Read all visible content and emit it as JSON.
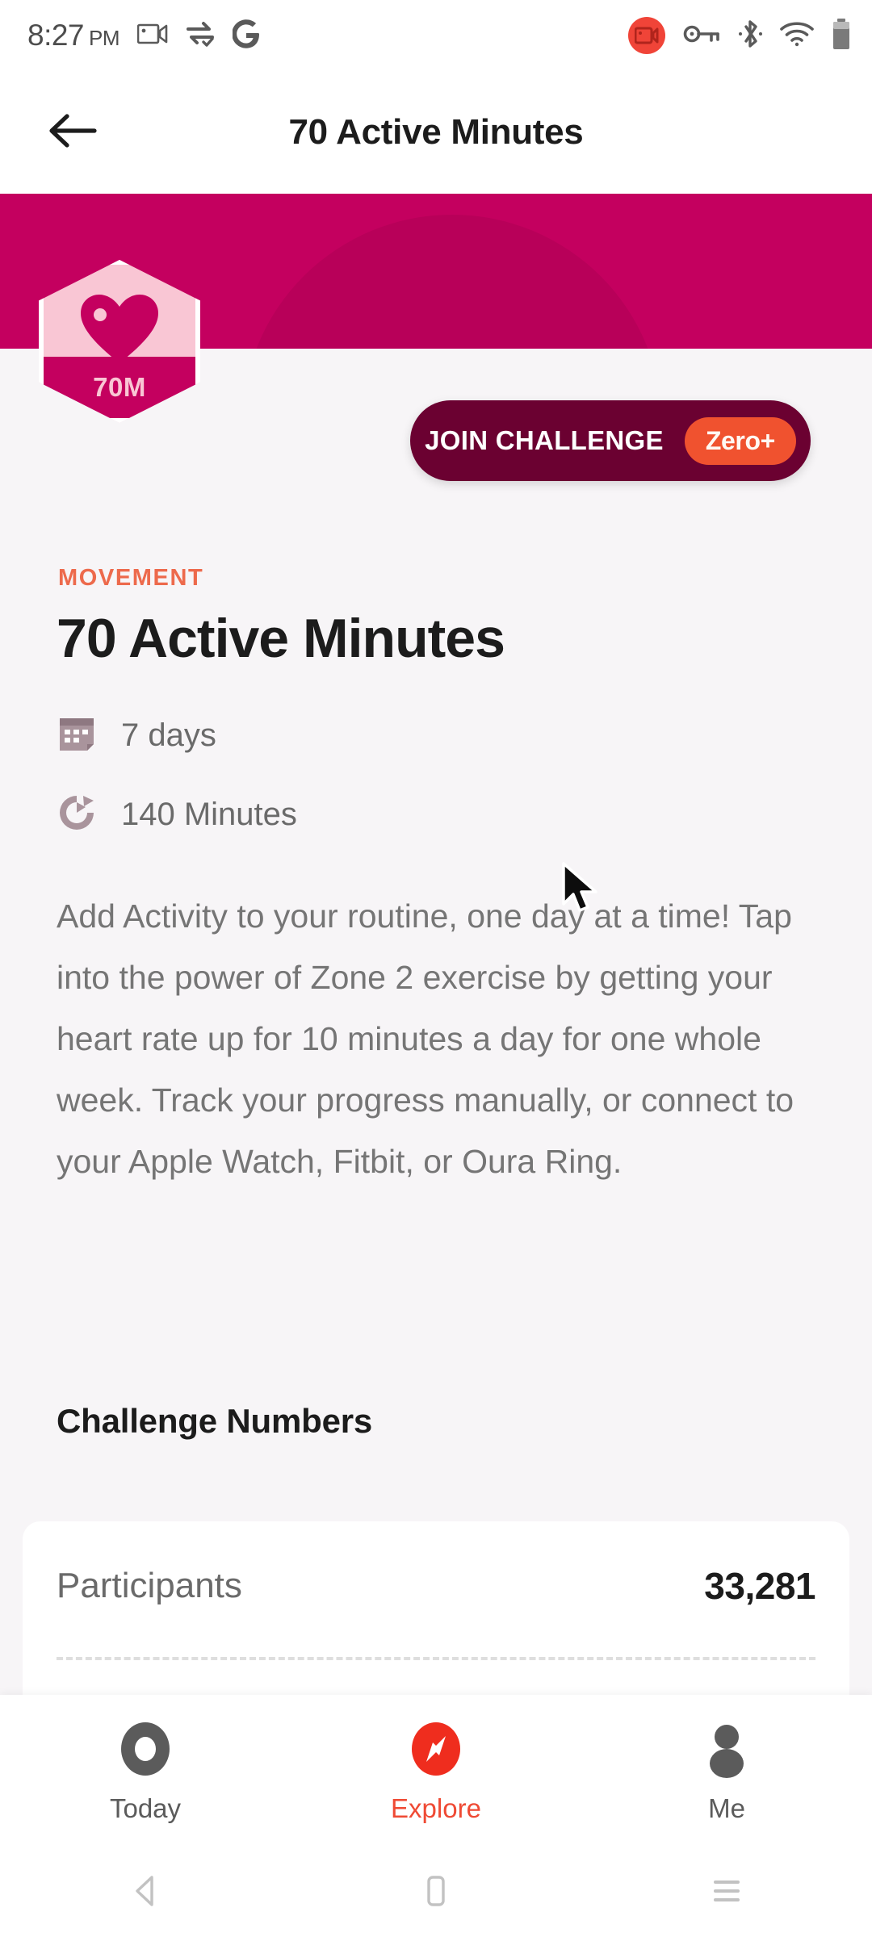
{
  "status_bar": {
    "time": "8:27",
    "ampm": "PM",
    "icons": [
      "screen-record-icon",
      "sync-icon",
      "google-icon",
      "recording-indicator-icon",
      "vpn-key-icon",
      "bluetooth-icon",
      "wifi-icon",
      "battery-icon"
    ]
  },
  "app_bar": {
    "back_icon": "back-arrow-icon",
    "title": "70 Active Minutes"
  },
  "hero": {
    "banner_color": "#c4005f",
    "badge": {
      "icon": "heart-icon",
      "label": "70M",
      "fill_color": "#f9c6d4",
      "accent_color": "#c4005f"
    }
  },
  "join_button": {
    "label": "JOIN CHALLENGE",
    "badge": "Zero+",
    "bg_color": "#6b0131",
    "badge_color": "#f0522f"
  },
  "challenge": {
    "kicker": "MOVEMENT",
    "kicker_color": "#ed6a4c",
    "title": "70 Active Minutes",
    "meta": [
      {
        "icon": "calendar-icon",
        "text": "7 days"
      },
      {
        "icon": "goal-target-icon",
        "text": "140 Minutes"
      }
    ],
    "description": "Add Activity to your routine, one day at a time! Tap into the power of Zone 2 exercise by getting your heart rate up for 10 minutes a day for one whole week. Track your progress manually, or connect to your Apple Watch, Fitbit, or Oura Ring."
  },
  "numbers_section": {
    "heading": "Challenge Numbers",
    "rows": [
      {
        "label": "Participants",
        "value": "33,281"
      }
    ]
  },
  "tab_bar": {
    "active": "Explore",
    "tabs": [
      {
        "label": "Today",
        "icon": "ring-icon",
        "active": false
      },
      {
        "label": "Explore",
        "icon": "compass-icon",
        "active": true
      },
      {
        "label": "Me",
        "icon": "person-icon",
        "active": false
      }
    ],
    "active_color": "#ef4a34"
  },
  "android_nav": {
    "buttons": [
      {
        "name": "back-nav-icon"
      },
      {
        "name": "home-nav-icon"
      },
      {
        "name": "recents-nav-icon"
      }
    ]
  }
}
